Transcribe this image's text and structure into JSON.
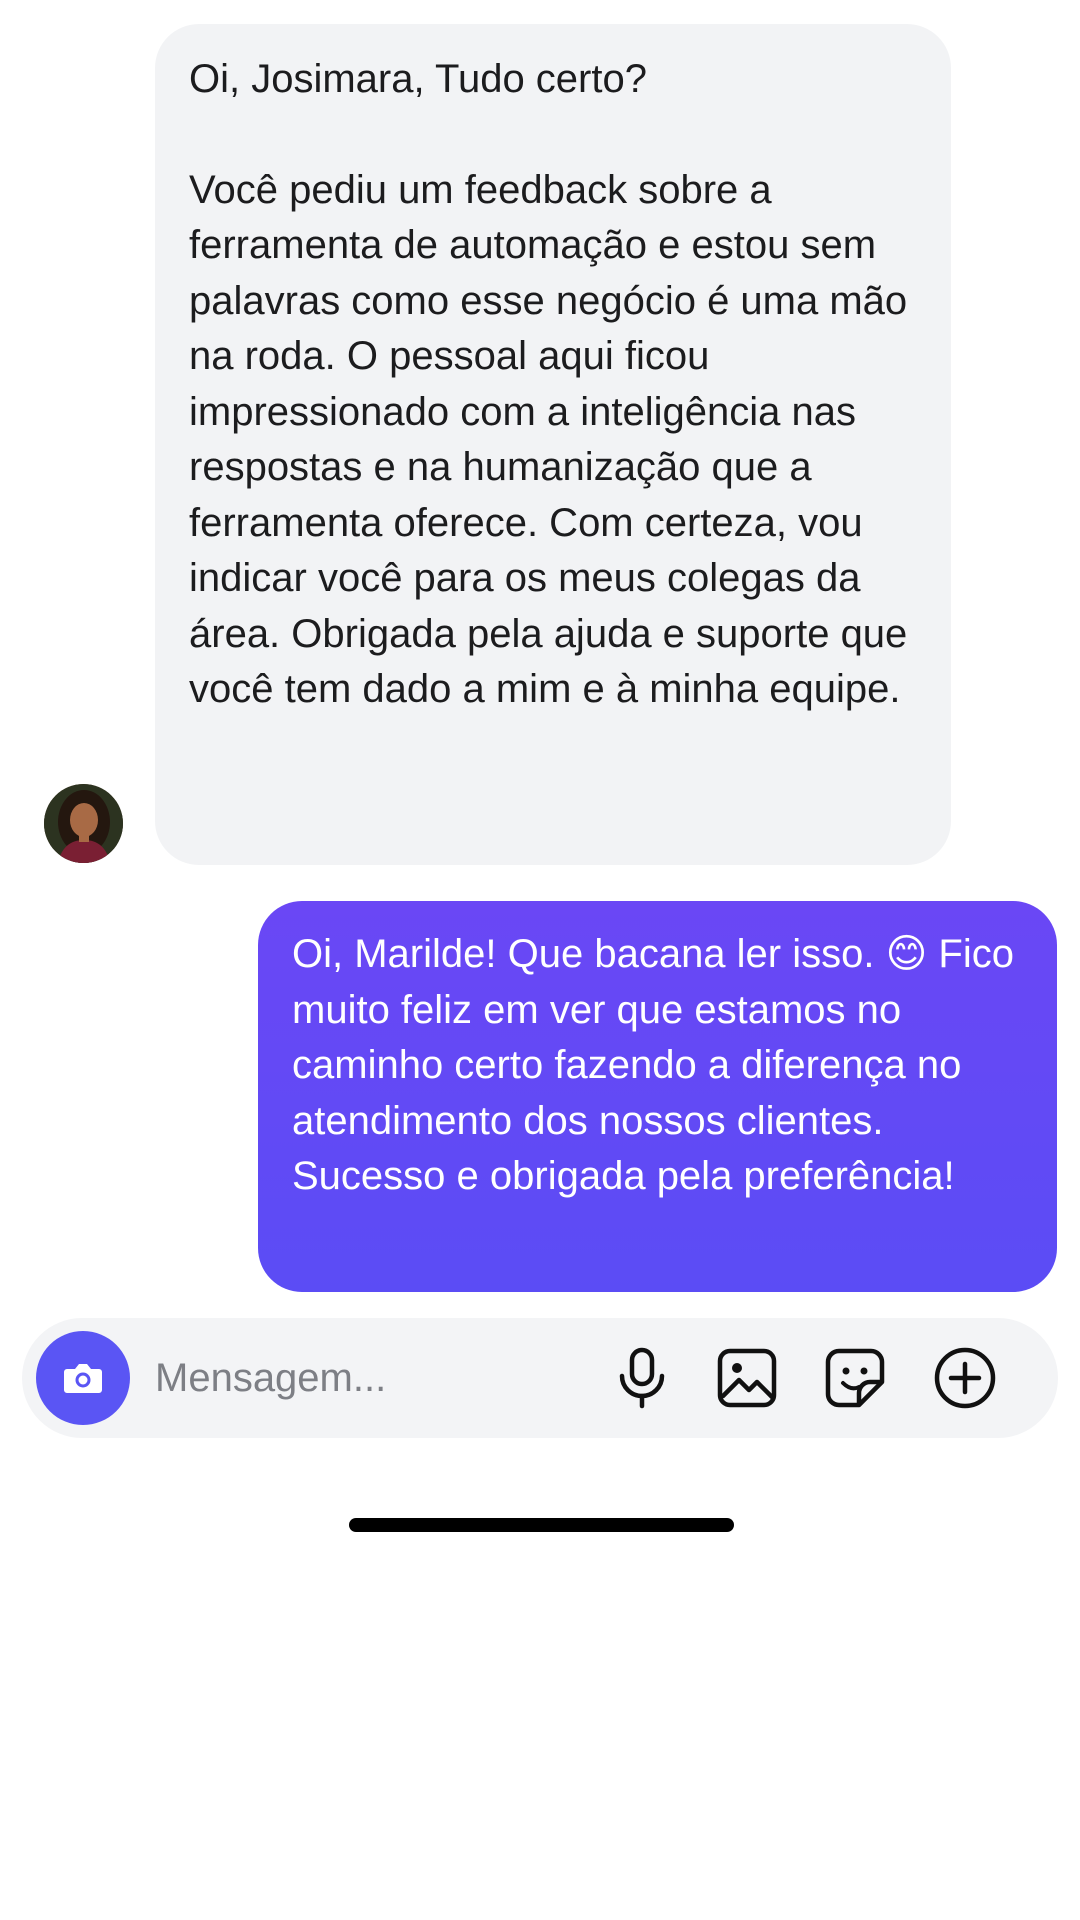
{
  "conversation": {
    "received": {
      "greeting": "Oi, Josimara, Tudo certo?",
      "body": "Você pediu um feedback sobre a ferramenta de automação e estou sem palavras como esse negócio é uma mão na roda. O pessoal aqui ficou impressionado com a inteligência nas respostas e na humanização que a ferramenta oferece. Com certeza, vou indicar você para os meus colegas da área. Obrigada pela ajuda e suporte que você tem dado a mim e à minha equipe."
    },
    "sent": {
      "body": "Oi, Marilde! Que bacana ler isso. 😊 Fico muito feliz em ver que estamos no caminho certo fazendo a diferença no atendimento dos nossos clientes. Sucesso e obrigada pela preferência!"
    }
  },
  "composer": {
    "placeholder": "Mensagem...",
    "icons": [
      "camera-icon",
      "microphone-icon",
      "image-icon",
      "sticker-icon",
      "plus-circle-icon"
    ]
  },
  "colors": {
    "sent_bubble": "#5b4cf5",
    "received_bubble": "#f2f3f5",
    "camera_button": "#5a55f4",
    "composer_bg": "#f3f4f6"
  }
}
